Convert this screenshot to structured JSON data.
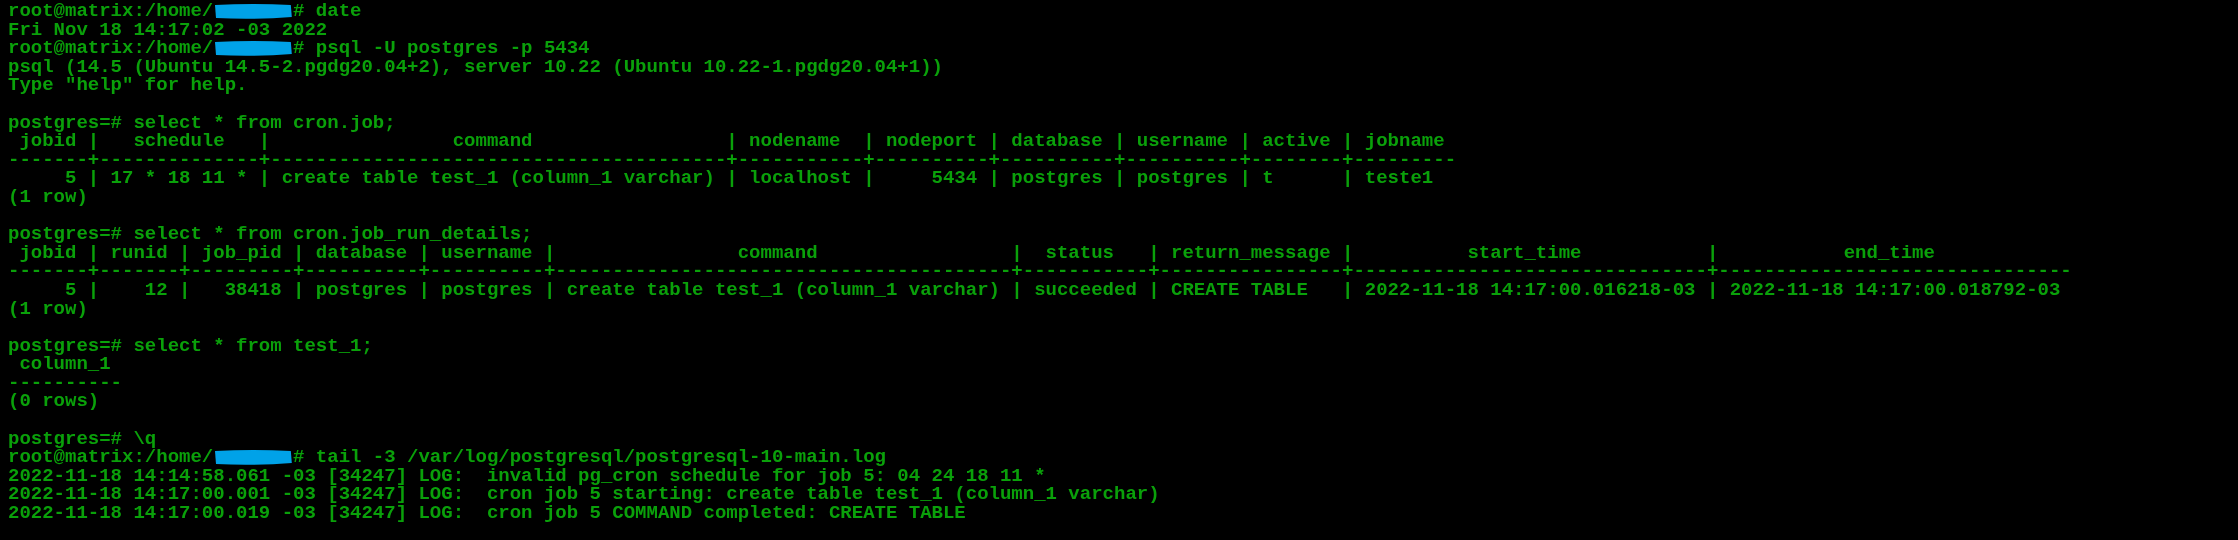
{
  "terminal": {
    "lines": [
      {
        "kind": "prompt",
        "prefix": "root@matrix:/home/",
        "command": "# date"
      },
      {
        "kind": "output",
        "text": "Fri Nov 18 14:17:02 -03 2022"
      },
      {
        "kind": "prompt",
        "prefix": "root@matrix:/home/",
        "command": "# psql -U postgres -p 5434"
      },
      {
        "kind": "output",
        "text": "psql (14.5 (Ubuntu 14.5-2.pgdg20.04+2), server 10.22 (Ubuntu 10.22-1.pgdg20.04+1))"
      },
      {
        "kind": "output",
        "text": "Type \"help\" for help."
      },
      {
        "kind": "blank"
      },
      {
        "kind": "output",
        "text": "postgres=# select * from cron.job;"
      },
      {
        "kind": "output",
        "text": " jobid |   schedule   |                command                 | nodename  | nodeport | database | username | active | jobname"
      },
      {
        "kind": "output",
        "text": "-------+--------------+----------------------------------------+-----------+----------+----------+----------+--------+---------"
      },
      {
        "kind": "output",
        "text": "     5 | 17 * 18 11 * | create table test_1 (column_1 varchar) | localhost |     5434 | postgres | postgres | t      | teste1"
      },
      {
        "kind": "output",
        "text": "(1 row)"
      },
      {
        "kind": "blank"
      },
      {
        "kind": "output",
        "text": "postgres=# select * from cron.job_run_details;"
      },
      {
        "kind": "output",
        "text": " jobid | runid | job_pid | database | username |                command                 |  status   | return_message |          start_time           |           end_time"
      },
      {
        "kind": "output",
        "text": "-------+-------+---------+----------+----------+----------------------------------------+-----------+----------------+-------------------------------+-------------------------------"
      },
      {
        "kind": "output",
        "text": "     5 |    12 |   38418 | postgres | postgres | create table test_1 (column_1 varchar) | succeeded | CREATE TABLE   | 2022-11-18 14:17:00.016218-03 | 2022-11-18 14:17:00.018792-03"
      },
      {
        "kind": "output",
        "text": "(1 row)"
      },
      {
        "kind": "blank"
      },
      {
        "kind": "output",
        "text": "postgres=# select * from test_1;"
      },
      {
        "kind": "output",
        "text": " column_1"
      },
      {
        "kind": "output",
        "text": "----------"
      },
      {
        "kind": "output",
        "text": "(0 rows)"
      },
      {
        "kind": "blank"
      },
      {
        "kind": "output",
        "text": "postgres=# \\q"
      },
      {
        "kind": "prompt",
        "prefix": "root@matrix:/home/",
        "command": "# tail -3 /var/log/postgresql/postgresql-10-main.log"
      },
      {
        "kind": "output",
        "text": "2022-11-18 14:14:58.061 -03 [34247] LOG:  invalid pg_cron schedule for job 5: 04 24 18 11 *"
      },
      {
        "kind": "output",
        "text": "2022-11-18 14:17:00.001 -03 [34247] LOG:  cron job 5 starting: create table test_1 (column_1 varchar)"
      },
      {
        "kind": "output",
        "text": "2022-11-18 14:17:00.019 -03 [34247] LOG:  cron job 5 COMMAND completed: CREATE TABLE"
      }
    ]
  }
}
